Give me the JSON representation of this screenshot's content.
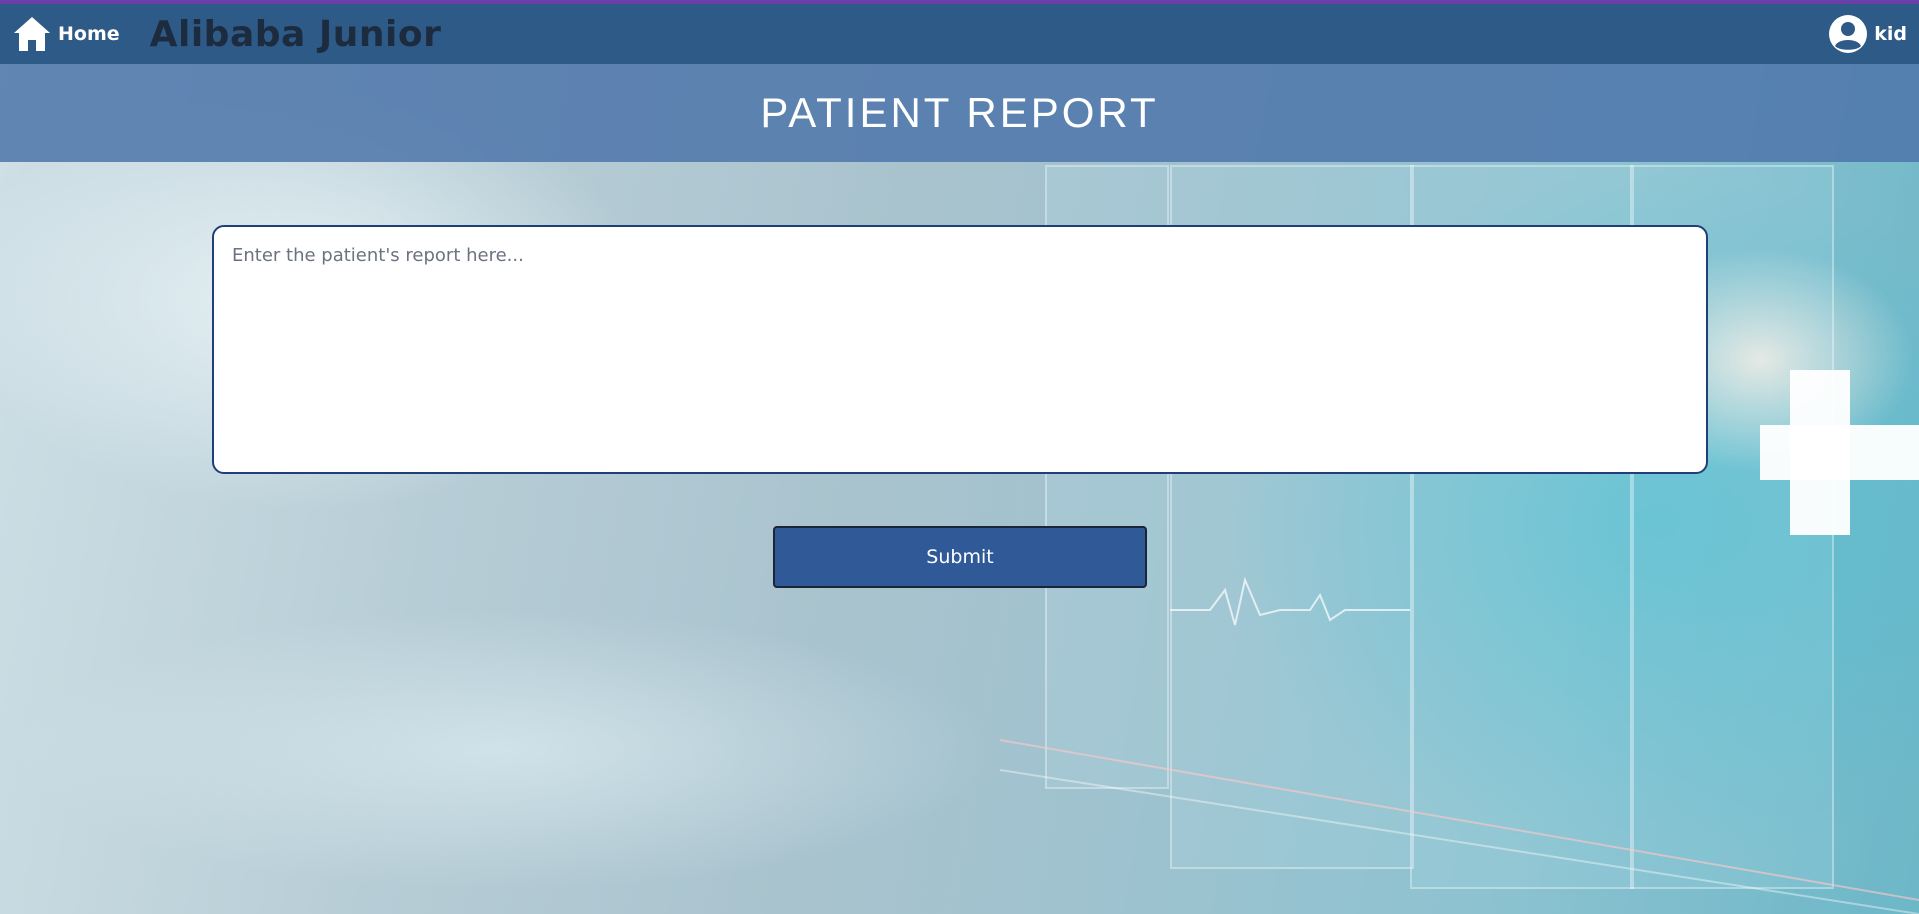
{
  "nav": {
    "home_label": "Home",
    "brand": "Alibaba Junior",
    "user_label": "kid"
  },
  "banner": {
    "title": "PATIENT REPORT"
  },
  "form": {
    "report_placeholder": "Enter the patient's report here...",
    "report_value": "",
    "submit_label": "Submit"
  },
  "colors": {
    "accent_line": "#6a3fa8",
    "navbar": "#2e5a88",
    "banner": "#4e76aa",
    "button": "#2f5a97",
    "input_border": "#1e3f77"
  },
  "icons": {
    "home": "home-icon",
    "user": "user-circle-icon"
  }
}
